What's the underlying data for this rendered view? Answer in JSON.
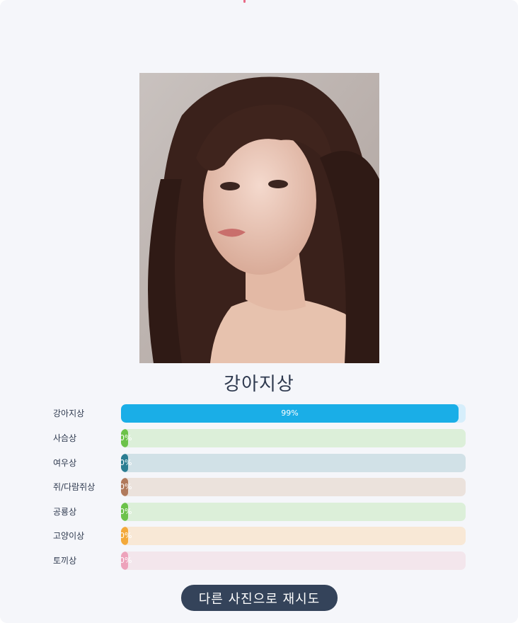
{
  "result": {
    "title": "강아지상"
  },
  "bars": [
    {
      "label": "강아지상",
      "percent": 99,
      "percent_text": "99%",
      "fill_color": "#1aaee7",
      "track_color": "#d6eefb"
    },
    {
      "label": "사슴상",
      "percent": 0,
      "percent_text": "0%",
      "fill_color": "#6cc24a",
      "track_color": "#dcefd9"
    },
    {
      "label": "여우상",
      "percent": 0,
      "percent_text": "0%",
      "fill_color": "#2b7d92",
      "track_color": "#d1e1e7"
    },
    {
      "label": "쥐/다람쥐상",
      "percent": 0,
      "percent_text": "0%",
      "fill_color": "#b17a5c",
      "track_color": "#ebe2dc"
    },
    {
      "label": "공룡상",
      "percent": 0,
      "percent_text": "0%",
      "fill_color": "#6cc24a",
      "track_color": "#dcefd9"
    },
    {
      "label": "고양이상",
      "percent": 0,
      "percent_text": "0%",
      "fill_color": "#f3a93a",
      "track_color": "#f8e8d6"
    },
    {
      "label": "토끼상",
      "percent": 0,
      "percent_text": "0%",
      "fill_color": "#eda3bb",
      "track_color": "#f3e6ec"
    }
  ],
  "retry_button": {
    "label": "다른 사진으로 재시도"
  },
  "colors": {
    "background": "#f5f6fa",
    "title_text": "#2f3a4f",
    "button": "#34435a",
    "accent": "#e86a86"
  }
}
